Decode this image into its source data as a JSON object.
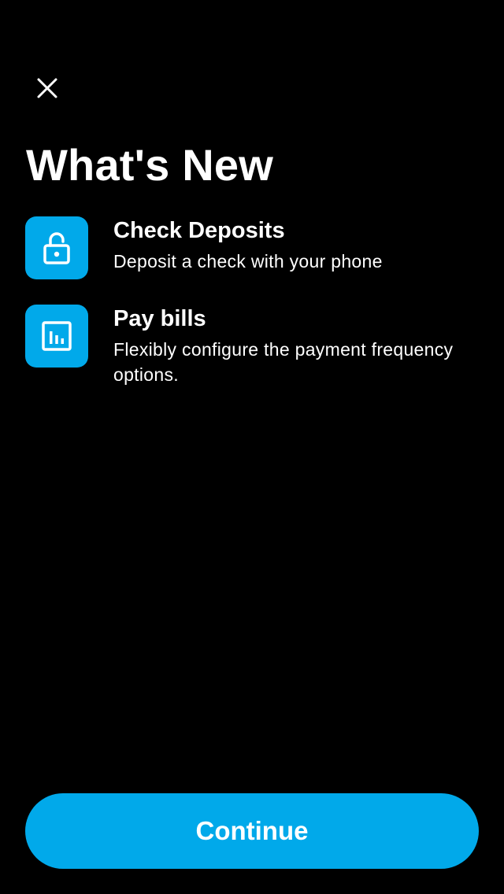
{
  "header": {
    "close_icon": "close-icon",
    "title": "What's New"
  },
  "features": [
    {
      "icon": "unlock-icon",
      "title": "Check Deposits",
      "description": "Deposit a check with your phone"
    },
    {
      "icon": "bar-chart-icon",
      "title": "Pay bills",
      "description": "Flexibly configure the payment frequency options."
    }
  ],
  "footer": {
    "continue_label": "Continue"
  },
  "colors": {
    "accent": "#01a9ea",
    "background": "#000000",
    "text": "#ffffff"
  }
}
